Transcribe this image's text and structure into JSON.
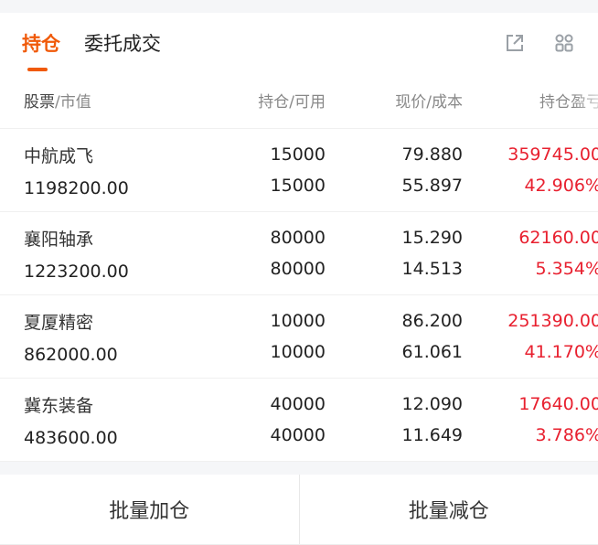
{
  "tabs": [
    {
      "label": "持仓"
    },
    {
      "label": "委托成交"
    }
  ],
  "icons": {
    "share": "external-link-icon",
    "grid": "grid-icon"
  },
  "header": {
    "stock_a": "股票",
    "stock_b": "/市值",
    "position": "持仓/可用",
    "price": "现价/成本",
    "profit": "持仓盈亏"
  },
  "rows": [
    {
      "name": "中航成飞",
      "market_value": "1198200.00",
      "hold": "15000",
      "available": "15000",
      "price": "79.880",
      "cost": "55.897",
      "pnl": "359745.00",
      "pnl_pct": "42.906%"
    },
    {
      "name": "襄阳轴承",
      "market_value": "1223200.00",
      "hold": "80000",
      "available": "80000",
      "price": "15.290",
      "cost": "14.513",
      "pnl": "62160.00",
      "pnl_pct": "5.354%"
    },
    {
      "name": "夏厦精密",
      "market_value": "862000.00",
      "hold": "10000",
      "available": "10000",
      "price": "86.200",
      "cost": "61.061",
      "pnl": "251390.00",
      "pnl_pct": "41.170%"
    },
    {
      "name": "冀东装备",
      "market_value": "483600.00",
      "hold": "40000",
      "available": "40000",
      "price": "12.090",
      "cost": "11.649",
      "pnl": "17640.00",
      "pnl_pct": "3.786%"
    }
  ],
  "footer": {
    "batch_add": "批量加仓",
    "batch_reduce": "批量减仓"
  },
  "colors": {
    "accent": "#f05a0a",
    "profit": "#e8202f"
  }
}
